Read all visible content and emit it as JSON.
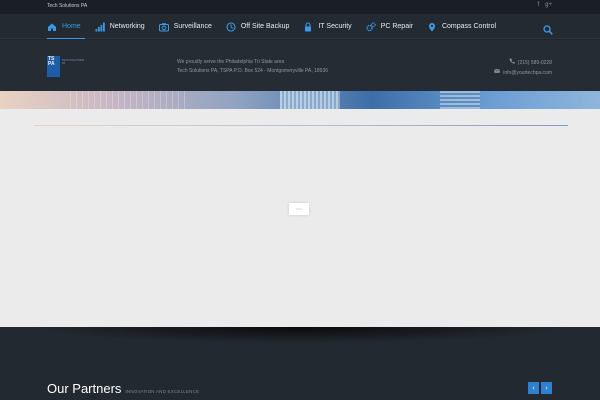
{
  "topbar": {
    "site_name": "Tech Solutions PA",
    "social": [
      {
        "icon": "facebook-icon",
        "glyph": "f"
      },
      {
        "icon": "google-plus-icon",
        "glyph": "g+"
      }
    ]
  },
  "nav": {
    "items": [
      {
        "label": "Home",
        "icon": "home-icon",
        "active": true
      },
      {
        "label": "Networking",
        "icon": "signal-bars-icon"
      },
      {
        "label": "Surveillance",
        "icon": "camera-icon"
      },
      {
        "label": "Off Site Backup",
        "icon": "clock-icon"
      },
      {
        "label": "IT Security",
        "icon": "lock-icon"
      },
      {
        "label": "PC Repair",
        "icon": "gears-icon"
      },
      {
        "label": "Compass Control",
        "icon": "map-pin-icon"
      }
    ],
    "search_icon": "search-icon",
    "accent": "#3a9ae8"
  },
  "header": {
    "logo": {
      "mark": "TS PA",
      "tagline": "TECH SOLUTIONS PA"
    },
    "serve_line1": "We proudly serve the Philadelphia Tri State area",
    "serve_line2": "Tech Solutions PA, TSPA P.O. Box 524 - Montgomeryville PA, 18936",
    "phone": "(215) 589-0228",
    "email": "info@yourtechpa.com"
  },
  "slider": {
    "loader_glyph": "⋯"
  },
  "partners": {
    "title": "Our Partners",
    "subtitle": "INNOVATION AND EXCELLENCE",
    "prev_glyph": "‹",
    "next_glyph": "›"
  }
}
